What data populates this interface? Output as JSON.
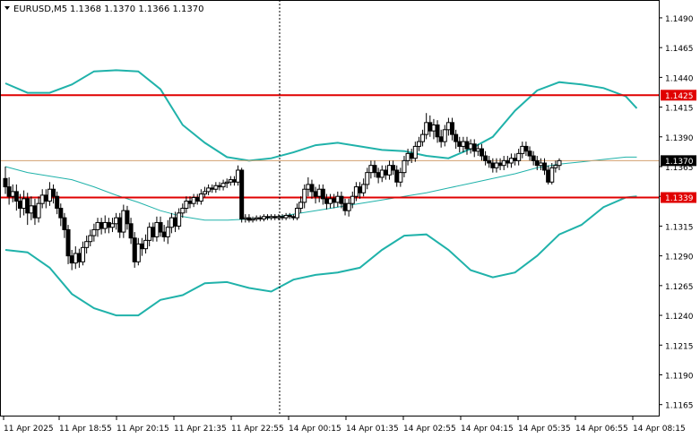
{
  "header": {
    "symbol": "EURUSD,M5",
    "ohlc": "1.1368 1.1370 1.1366 1.1370"
  },
  "colors": {
    "background": "#ffffff",
    "frame": "#000000",
    "candle": "#000000",
    "bollinger": "#20b2aa",
    "level": "#e00000",
    "price_line": "#d2a070",
    "price_tag_bg": "#000000",
    "level_tag_bg": "#e00000",
    "crosshair": "#000000"
  },
  "chart_data": {
    "type": "candlestick",
    "ylim": [
      1.1155,
      1.1505
    ],
    "y_ticks": [
      "1.1490",
      "1.1465",
      "1.1440",
      "1.1415",
      "1.1390",
      "1.1365",
      "1.1340",
      "1.1315",
      "1.1290",
      "1.1265",
      "1.1240",
      "1.1215",
      "1.1190",
      "1.1165"
    ],
    "x_ticks": [
      "11 Apr 2025",
      "11 Apr 18:55",
      "11 Apr 20:15",
      "11 Apr 21:35",
      "11 Apr 22:55",
      "14 Apr 00:15",
      "14 Apr 01:35",
      "14 Apr 02:55",
      "14 Apr 04:15",
      "14 Apr 05:35",
      "14 Apr 06:55",
      "14 Apr 08:15"
    ],
    "levels": [
      {
        "value": 1.1425,
        "label": "1.1425"
      },
      {
        "value": 1.1339,
        "label": "1.1339"
      }
    ],
    "current_price": {
      "value": 1.137,
      "label": "1.1370"
    },
    "crosshair_time": "11 Apr 22:55",
    "series": [
      {
        "name": "",
        "kind": "bollinger-upper",
        "x": [
          0,
          6,
          12,
          18,
          24,
          30,
          36,
          42,
          48,
          54,
          60,
          66,
          72,
          78,
          84,
          90,
          96,
          102,
          108,
          114,
          120,
          126,
          132,
          138,
          144,
          150,
          156,
          162,
          168,
          171
        ],
        "y": [
          1.1435,
          1.1427,
          1.1427,
          1.1434,
          1.1445,
          1.1446,
          1.1445,
          1.143,
          1.14,
          1.1385,
          1.1373,
          1.137,
          1.1372,
          1.1377,
          1.1383,
          1.1385,
          1.1382,
          1.1379,
          1.1378,
          1.1374,
          1.1372,
          1.138,
          1.139,
          1.1412,
          1.1429,
          1.1436,
          1.1434,
          1.1431,
          1.1424,
          1.1414
        ]
      },
      {
        "name": "",
        "kind": "bollinger-middle",
        "x": [
          0,
          6,
          12,
          18,
          24,
          30,
          36,
          42,
          48,
          54,
          60,
          66,
          72,
          78,
          84,
          90,
          96,
          102,
          108,
          114,
          120,
          126,
          132,
          138,
          144,
          150,
          156,
          162,
          168,
          171
        ],
        "y": [
          1.1365,
          1.136,
          1.1357,
          1.1354,
          1.1348,
          1.1341,
          1.1335,
          1.1328,
          1.1323,
          1.132,
          1.132,
          1.1321,
          1.1322,
          1.1325,
          1.1328,
          1.1331,
          1.1334,
          1.1337,
          1.134,
          1.1343,
          1.1347,
          1.1351,
          1.1355,
          1.1359,
          1.1364,
          1.1367,
          1.1369,
          1.1371,
          1.1373,
          1.1373
        ]
      },
      {
        "name": "",
        "kind": "bollinger-lower",
        "x": [
          0,
          6,
          12,
          18,
          24,
          30,
          36,
          42,
          48,
          54,
          60,
          66,
          72,
          78,
          84,
          90,
          96,
          102,
          108,
          114,
          120,
          126,
          132,
          138,
          144,
          150,
          156,
          162,
          168,
          171
        ],
        "y": [
          1.1295,
          1.1293,
          1.128,
          1.1258,
          1.1246,
          1.124,
          1.124,
          1.1253,
          1.1257,
          1.1267,
          1.1268,
          1.1263,
          1.126,
          1.127,
          1.1274,
          1.1276,
          1.128,
          1.1295,
          1.1307,
          1.1308,
          1.1295,
          1.1278,
          1.1272,
          1.1276,
          1.129,
          1.1308,
          1.1316,
          1.1331,
          1.1339,
          1.134
        ]
      }
    ],
    "candles": [
      [
        1.1355,
        1.1348,
        1.1365,
        1.1342
      ],
      [
        1.1348,
        1.134,
        1.1356,
        1.1333
      ],
      [
        1.134,
        1.1344,
        1.135,
        1.1335
      ],
      [
        1.1344,
        1.1336,
        1.135,
        1.1328
      ],
      [
        1.1336,
        1.133,
        1.1342,
        1.1322
      ],
      [
        1.133,
        1.1338,
        1.1345,
        1.1324
      ],
      [
        1.1338,
        1.1326,
        1.1343,
        1.1316
      ],
      [
        1.1326,
        1.1332,
        1.134,
        1.132
      ],
      [
        1.1332,
        1.1322,
        1.1338,
        1.1316
      ],
      [
        1.1322,
        1.1334,
        1.134,
        1.1318
      ],
      [
        1.1334,
        1.1341,
        1.1346,
        1.133
      ],
      [
        1.1341,
        1.1336,
        1.1346,
        1.133
      ],
      [
        1.1336,
        1.1346,
        1.1352,
        1.1332
      ],
      [
        1.1346,
        1.134,
        1.135,
        1.1334
      ],
      [
        1.134,
        1.133,
        1.1344,
        1.1325
      ],
      [
        1.133,
        1.1322,
        1.1334,
        1.1315
      ],
      [
        1.1322,
        1.1312,
        1.1326,
        1.1305
      ],
      [
        1.1312,
        1.129,
        1.1316,
        1.1283
      ],
      [
        1.129,
        1.1284,
        1.1295,
        1.1278
      ],
      [
        1.1284,
        1.1292,
        1.1298,
        1.1279
      ],
      [
        1.1292,
        1.1285,
        1.1296,
        1.128
      ],
      [
        1.1285,
        1.1297,
        1.1302,
        1.1282
      ],
      [
        1.1297,
        1.1302,
        1.1307,
        1.1292
      ],
      [
        1.1302,
        1.1307,
        1.1312,
        1.1298
      ],
      [
        1.1307,
        1.1312,
        1.1317,
        1.1302
      ],
      [
        1.1312,
        1.1318,
        1.1322,
        1.1306
      ],
      [
        1.1318,
        1.1313,
        1.1322,
        1.1308
      ],
      [
        1.1313,
        1.1318,
        1.1324,
        1.1309
      ],
      [
        1.1318,
        1.1314,
        1.1322,
        1.1309
      ],
      [
        1.1314,
        1.1317,
        1.1322,
        1.131
      ],
      [
        1.1317,
        1.1322,
        1.1326,
        1.1312
      ],
      [
        1.1322,
        1.131,
        1.1326,
        1.1305
      ],
      [
        1.131,
        1.1328,
        1.1333,
        1.1305
      ],
      [
        1.1328,
        1.1317,
        1.1332,
        1.1312
      ],
      [
        1.1317,
        1.1305,
        1.1322,
        1.13
      ],
      [
        1.1305,
        1.1285,
        1.131,
        1.128
      ],
      [
        1.1285,
        1.13,
        1.1305,
        1.1282
      ],
      [
        1.13,
        1.1296,
        1.1305,
        1.129
      ],
      [
        1.1296,
        1.1303,
        1.1308,
        1.1292
      ],
      [
        1.1303,
        1.1314,
        1.1318,
        1.1298
      ],
      [
        1.1314,
        1.1306,
        1.1318,
        1.1302
      ],
      [
        1.1306,
        1.1318,
        1.1323,
        1.1302
      ],
      [
        1.1318,
        1.131,
        1.1323,
        1.1306
      ],
      [
        1.131,
        1.1306,
        1.1316,
        1.1302
      ],
      [
        1.1306,
        1.1314,
        1.132,
        1.13
      ],
      [
        1.1314,
        1.1322,
        1.1326,
        1.1309
      ],
      [
        1.1322,
        1.1315,
        1.1327,
        1.131
      ],
      [
        1.1315,
        1.1326,
        1.133,
        1.1312
      ],
      [
        1.1326,
        1.133,
        1.1334,
        1.1322
      ],
      [
        1.133,
        1.1336,
        1.134,
        1.1326
      ],
      [
        1.1336,
        1.1334,
        1.134,
        1.133
      ],
      [
        1.1334,
        1.1339,
        1.1342,
        1.1331
      ],
      [
        1.1339,
        1.1336,
        1.1342,
        1.1333
      ],
      [
        1.1336,
        1.1342,
        1.1346,
        1.1333
      ],
      [
        1.1342,
        1.1344,
        1.1348,
        1.1339
      ],
      [
        1.1344,
        1.1347,
        1.135,
        1.1341
      ],
      [
        1.1347,
        1.1346,
        1.135,
        1.1343
      ],
      [
        1.1346,
        1.1349,
        1.1352,
        1.1343
      ],
      [
        1.1349,
        1.1348,
        1.1352,
        1.1345
      ],
      [
        1.1348,
        1.1351,
        1.1354,
        1.1345
      ],
      [
        1.1351,
        1.1352,
        1.1355,
        1.1347
      ],
      [
        1.1352,
        1.1354,
        1.1357,
        1.1349
      ],
      [
        1.1354,
        1.1352,
        1.1357,
        1.1349
      ],
      [
        1.1352,
        1.1362,
        1.1366,
        1.1349
      ],
      [
        1.1362,
        1.1321,
        1.1364,
        1.1318
      ],
      [
        1.1321,
        1.1322,
        1.1325,
        1.1318
      ],
      [
        1.1322,
        1.132,
        1.1325,
        1.1318
      ],
      [
        1.132,
        1.1321,
        1.1323,
        1.1318
      ],
      [
        1.1321,
        1.1322,
        1.1324,
        1.1319
      ],
      [
        1.1322,
        1.1321,
        1.1324,
        1.1319
      ],
      [
        1.1321,
        1.1323,
        1.1325,
        1.1319
      ],
      [
        1.1323,
        1.1322,
        1.1325,
        1.132
      ],
      [
        1.1322,
        1.1323,
        1.1325,
        1.132
      ],
      [
        1.1323,
        1.1322,
        1.1325,
        1.132
      ],
      [
        1.1322,
        1.1323,
        1.1325,
        1.132
      ],
      [
        1.1323,
        1.1322,
        1.1325,
        1.132
      ],
      [
        1.1322,
        1.1324,
        1.1326,
        1.132
      ],
      [
        1.1324,
        1.1323,
        1.1326,
        1.1321
      ],
      [
        1.1323,
        1.1322,
        1.1325,
        1.132
      ],
      [
        1.1322,
        1.133,
        1.1334,
        1.132
      ],
      [
        1.133,
        1.1335,
        1.134,
        1.1326
      ],
      [
        1.1335,
        1.1346,
        1.135,
        1.133
      ],
      [
        1.1346,
        1.135,
        1.1356,
        1.134
      ],
      [
        1.135,
        1.1344,
        1.1354,
        1.1338
      ],
      [
        1.1344,
        1.134,
        1.1348,
        1.1334
      ],
      [
        1.134,
        1.1346,
        1.135,
        1.1335
      ],
      [
        1.1346,
        1.1338,
        1.135,
        1.1333
      ],
      [
        1.1338,
        1.1334,
        1.1342,
        1.1329
      ],
      [
        1.1334,
        1.1338,
        1.1342,
        1.133
      ],
      [
        1.1338,
        1.1335,
        1.1342,
        1.133
      ],
      [
        1.1335,
        1.134,
        1.1344,
        1.1331
      ],
      [
        1.134,
        1.1334,
        1.1344,
        1.133
      ],
      [
        1.1334,
        1.1328,
        1.1338,
        1.1324
      ],
      [
        1.1328,
        1.1334,
        1.1338,
        1.1323
      ],
      [
        1.1334,
        1.134,
        1.1344,
        1.133
      ],
      [
        1.134,
        1.1348,
        1.1352,
        1.1336
      ],
      [
        1.1348,
        1.1343,
        1.1352,
        1.1338
      ],
      [
        1.1343,
        1.135,
        1.1355,
        1.134
      ],
      [
        1.135,
        1.136,
        1.1364,
        1.1346
      ],
      [
        1.136,
        1.1366,
        1.137,
        1.1355
      ],
      [
        1.1366,
        1.136,
        1.137,
        1.1356
      ],
      [
        1.136,
        1.1356,
        1.1364,
        1.1351
      ],
      [
        1.1356,
        1.1362,
        1.1366,
        1.1352
      ],
      [
        1.1362,
        1.1358,
        1.1366,
        1.1354
      ],
      [
        1.1358,
        1.1366,
        1.137,
        1.1354
      ],
      [
        1.1366,
        1.1362,
        1.137,
        1.1358
      ],
      [
        1.1362,
        1.1352,
        1.1366,
        1.1348
      ],
      [
        1.1352,
        1.136,
        1.1364,
        1.1348
      ],
      [
        1.136,
        1.137,
        1.1374,
        1.1356
      ],
      [
        1.137,
        1.1376,
        1.138,
        1.1366
      ],
      [
        1.1376,
        1.1372,
        1.138,
        1.1368
      ],
      [
        1.1372,
        1.1382,
        1.1386,
        1.1369
      ],
      [
        1.1382,
        1.1386,
        1.139,
        1.1378
      ],
      [
        1.1386,
        1.1392,
        1.1396,
        1.1382
      ],
      [
        1.1392,
        1.1402,
        1.141,
        1.1388
      ],
      [
        1.1402,
        1.1395,
        1.1408,
        1.139
      ],
      [
        1.1395,
        1.14,
        1.1405,
        1.1388
      ],
      [
        1.14,
        1.139,
        1.1404,
        1.1385
      ],
      [
        1.139,
        1.1386,
        1.1396,
        1.1381
      ],
      [
        1.1386,
        1.1396,
        1.14,
        1.1382
      ],
      [
        1.1396,
        1.1402,
        1.1406,
        1.1391
      ],
      [
        1.1402,
        1.1392,
        1.1406,
        1.1387
      ],
      [
        1.1392,
        1.1386,
        1.1396,
        1.138
      ],
      [
        1.1386,
        1.1382,
        1.139,
        1.1377
      ],
      [
        1.1382,
        1.1386,
        1.139,
        1.1377
      ],
      [
        1.1386,
        1.138,
        1.139,
        1.1375
      ],
      [
        1.138,
        1.1384,
        1.1388,
        1.1376
      ],
      [
        1.1384,
        1.1378,
        1.1388,
        1.1373
      ],
      [
        1.1378,
        1.138,
        1.1384,
        1.1374
      ],
      [
        1.138,
        1.1374,
        1.1384,
        1.137
      ],
      [
        1.1374,
        1.137,
        1.1378,
        1.1366
      ],
      [
        1.137,
        1.1368,
        1.1374,
        1.1364
      ],
      [
        1.1368,
        1.1364,
        1.1372,
        1.136
      ],
      [
        1.1364,
        1.1368,
        1.1372,
        1.136
      ],
      [
        1.1368,
        1.1366,
        1.1372,
        1.1362
      ],
      [
        1.1366,
        1.137,
        1.1374,
        1.1362
      ],
      [
        1.137,
        1.1368,
        1.1374,
        1.1364
      ],
      [
        1.1368,
        1.1372,
        1.1376,
        1.1364
      ],
      [
        1.1372,
        1.137,
        1.1376,
        1.1366
      ],
      [
        1.137,
        1.1376,
        1.138,
        1.1366
      ],
      [
        1.1376,
        1.1382,
        1.1386,
        1.1372
      ],
      [
        1.1382,
        1.1378,
        1.1386,
        1.1374
      ],
      [
        1.1378,
        1.1374,
        1.1382,
        1.137
      ],
      [
        1.1374,
        1.137,
        1.1378,
        1.1366
      ],
      [
        1.137,
        1.1366,
        1.1374,
        1.1362
      ],
      [
        1.1366,
        1.1368,
        1.1372,
        1.1362
      ],
      [
        1.1368,
        1.1362,
        1.1372,
        1.1358
      ],
      [
        1.1362,
        1.1352,
        1.1366,
        1.135
      ],
      [
        1.1352,
        1.1364,
        1.1368,
        1.135
      ],
      [
        1.1364,
        1.1366,
        1.137,
        1.136
      ],
      [
        1.1366,
        1.137,
        1.1372,
        1.1362
      ]
    ]
  }
}
